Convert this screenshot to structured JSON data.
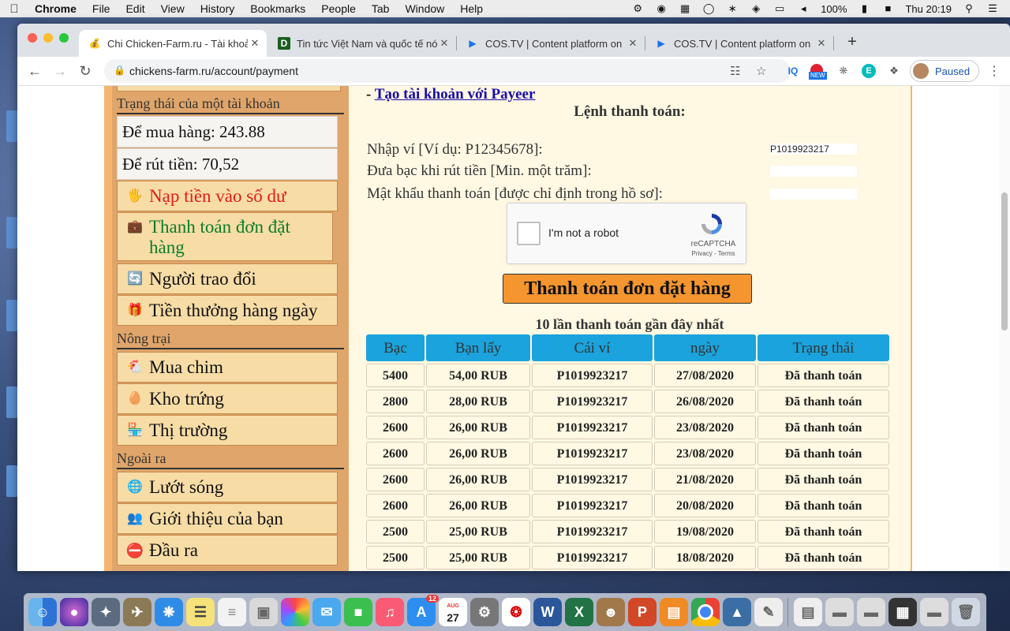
{
  "menubar": {
    "app": "Chrome",
    "items": [
      "File",
      "Edit",
      "View",
      "History",
      "Bookmarks",
      "People",
      "Tab",
      "Window",
      "Help"
    ],
    "battery": "100%",
    "clock": "Thu 20:19"
  },
  "tabs": [
    {
      "title": "Chi Chicken-Farm.ru - Tài khoả",
      "favicon": "money-bag-icon",
      "active": true
    },
    {
      "title": "Tin tức Việt Nam và quốc tế nó",
      "favicon": "d-letter-icon",
      "active": false
    },
    {
      "title": "COS.TV | Content platform on",
      "favicon": "play-icon",
      "active": false
    },
    {
      "title": "COS.TV | Content platform on",
      "favicon": "play-icon",
      "active": false
    }
  ],
  "toolbar": {
    "url": "chickens-farm.ru/account/payment",
    "profile_label": "Paused",
    "new_badge": "NEW"
  },
  "sidebar": {
    "status_heading": "Trạng thái của một tài khoản",
    "buy_balance": "Để mua hàng: 243.88",
    "withdraw_balance": "Để rút tiền: 70,52",
    "account_items": [
      {
        "label": "Nạp tiền vào số dư",
        "icon": "hand-coin-icon",
        "color": "#e41a1a"
      },
      {
        "label": "Thanh toán đơn đặt hàng",
        "icon": "wallet-icon",
        "color": "#0a7d2a"
      },
      {
        "label": "Người trao đổi",
        "icon": "exchange-icon"
      },
      {
        "label": "Tiền thưởng hàng ngày",
        "icon": "gift-icon"
      }
    ],
    "farm_heading": "Nông trại",
    "farm_items": [
      {
        "label": "Mua chim",
        "icon": "chicken-icon"
      },
      {
        "label": "Kho trứng",
        "icon": "egg-icon"
      },
      {
        "label": "Thị trường",
        "icon": "market-icon"
      }
    ],
    "other_heading": "Ngoài ra",
    "other_items": [
      {
        "label": "Lướt sóng",
        "icon": "surf-icon"
      },
      {
        "label": "Giới thiệu của bạn",
        "icon": "referral-icon"
      },
      {
        "label": "Đầu ra",
        "icon": "exit-icon"
      }
    ]
  },
  "main": {
    "payeer_prefix": "- ",
    "payeer_link": "Tạo tài khoản với Payeer",
    "order_title": "Lệnh thanh toán:",
    "fields": [
      {
        "label": "Nhập ví [Ví dụ: P12345678]:",
        "value": "P1019923217"
      },
      {
        "label": "Đưa bạc khi rút tiền [Min. một trăm]:",
        "value": ""
      },
      {
        "label": "Mật khẩu thanh toán [được chỉ định trong hồ sơ]:",
        "value": ""
      }
    ],
    "recaptcha": {
      "label": "I'm not a robot",
      "brand": "reCAPTCHA",
      "terms": "Privacy - Terms"
    },
    "pay_button": "Thanh toán đơn đặt hàng",
    "last_payments_title": "10 lần thanh toán gần đây nhất",
    "table_headers": [
      "Bạc",
      "Bạn lấy",
      "Cái ví",
      "ngày",
      "Trạng thái"
    ],
    "rows": [
      [
        "5400",
        "54,00 RUB",
        "P1019923217",
        "27/08/2020",
        "Đã thanh toán"
      ],
      [
        "2800",
        "28,00 RUB",
        "P1019923217",
        "26/08/2020",
        "Đã thanh toán"
      ],
      [
        "2600",
        "26,00 RUB",
        "P1019923217",
        "23/08/2020",
        "Đã thanh toán"
      ],
      [
        "2600",
        "26,00 RUB",
        "P1019923217",
        "23/08/2020",
        "Đã thanh toán"
      ],
      [
        "2600",
        "26,00 RUB",
        "P1019923217",
        "21/08/2020",
        "Đã thanh toán"
      ],
      [
        "2600",
        "26,00 RUB",
        "P1019923217",
        "20/08/2020",
        "Đã thanh toán"
      ],
      [
        "2500",
        "25,00 RUB",
        "P1019923217",
        "19/08/2020",
        "Đã thanh toán"
      ],
      [
        "2500",
        "25,00 RUB",
        "P1019923217",
        "18/08/2020",
        "Đã thanh toán"
      ]
    ]
  },
  "dock": {
    "calendar_month": "AUG",
    "calendar_day": "27",
    "appstore_badge": "12"
  }
}
